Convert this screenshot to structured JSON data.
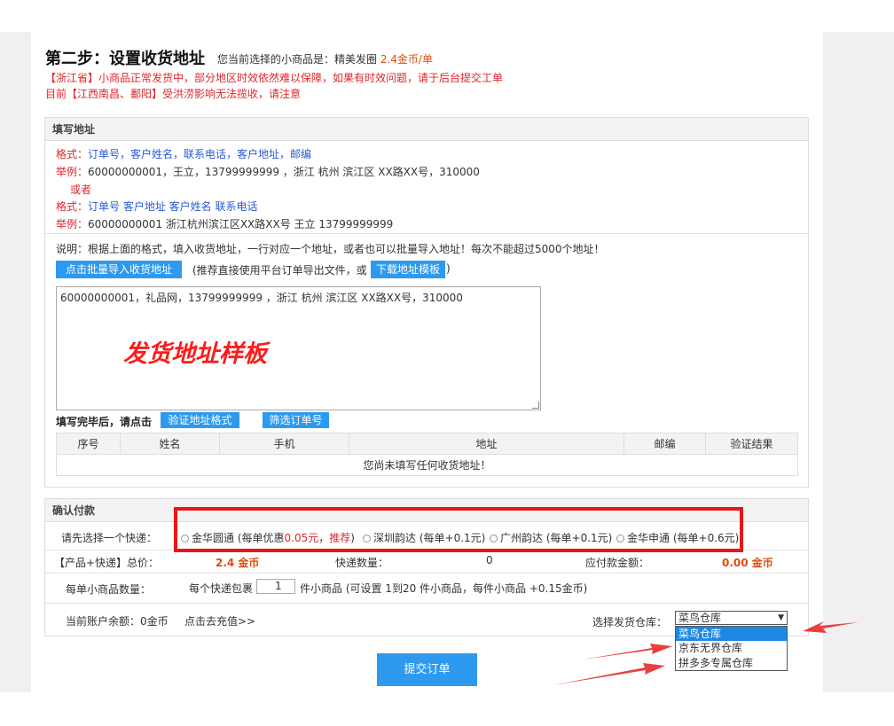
{
  "header": {
    "title": "第二步：设置收货地址",
    "subtitle_prefix": "您当前选择的小商品是：精美发圈",
    "subtitle_price": "2.4金币/单",
    "notice1": "【浙江省】小商品正常发货中，部分地区时效依然难以保障，如果有时效问题，请于后台提交工单",
    "notice2": "目前【江西南昌、鄱阳】受洪涝影响无法揽收，请注意"
  },
  "address_panel": {
    "heading": "填写地址",
    "format1_label": "格式：",
    "format1_value": "订单号，客户姓名，联系电话，客户地址，邮编",
    "example1_label": "举例：",
    "example1_value": "60000000001，王立，13799999999 ，浙江 杭州 滨江区 XX路XX号，310000",
    "or_text": "或者",
    "format2_label": "格式：",
    "format2_value": "订单号  客户地址  客户姓名  联系电话",
    "example2_label": "举例：",
    "example2_value": "60000000001 浙江杭州滨江区XX路XX号 王立 13799999999",
    "instruction": "说明：根据上面的格式，填入收货地址，一行对应一个地址，或者也可以批量导入地址！每次不能超过5000个地址！",
    "import_button": "点击批量导入收货地址",
    "recommend_text_open": "(推荐直接使用平台订单导出文件，或",
    "template_button": "下载地址模板",
    "recommend_text_close": ")",
    "textarea_value": "60000000001，礼品网，13799999999 ，浙江 杭州 滨江区 XX路XX号，310000",
    "watermark": "发货地址样板",
    "after_fill_label": "填写完毕后，请点击",
    "verify_button": "验证地址格式",
    "filter_button": "筛选订单号",
    "table_headers": [
      "序号",
      "姓名",
      "手机",
      "地址",
      "邮编",
      "验证结果"
    ],
    "empty_message": "您尚未填写任何收货地址！"
  },
  "payment_panel": {
    "heading": "确认付款",
    "express_label": "请先选择一个快递：",
    "express_options": [
      {
        "name": "金华圆通",
        "detail_open": "(每单优惠",
        "discount": "0.05元",
        "sep": "，",
        "recommend": "推荐",
        "detail_close": ")"
      },
      {
        "name": "深圳韵达",
        "detail": "(每单+0.1元)"
      },
      {
        "name": "广州韵达",
        "detail": "(每单+0.1元)"
      },
      {
        "name": "金华申通",
        "detail": "(每单+0.6元)"
      }
    ],
    "total_label": "【产品+快递】总价：",
    "total_value": "2.4 金币",
    "express_count_label": "快递数量：",
    "express_count_value": "0",
    "payable_label": "应付款金额：",
    "payable_value": "0.00 金币",
    "qty_label": "每单小商品数量：",
    "qty_prefix": "每个快递包裹",
    "qty_value": "1",
    "qty_suffix": "件小商品 (可设置 1到20 件小商品，每件小商品 +0.15金币)",
    "balance_label": "当前账户余额：",
    "balance_value": "0金币",
    "recharge_link": "点击去充值>>",
    "warehouse_label": "选择发货仓库：",
    "warehouse_selected": "菜鸟仓库",
    "warehouse_options": [
      "菜鸟仓库",
      "京东无界仓库",
      "拼多多专属仓库"
    ]
  },
  "submit_button": "提交订单",
  "colors": {
    "accent": "#2e9aef",
    "alert": "#e0262a",
    "price": "#e04a0a",
    "highlight_box": "#e8161b"
  }
}
